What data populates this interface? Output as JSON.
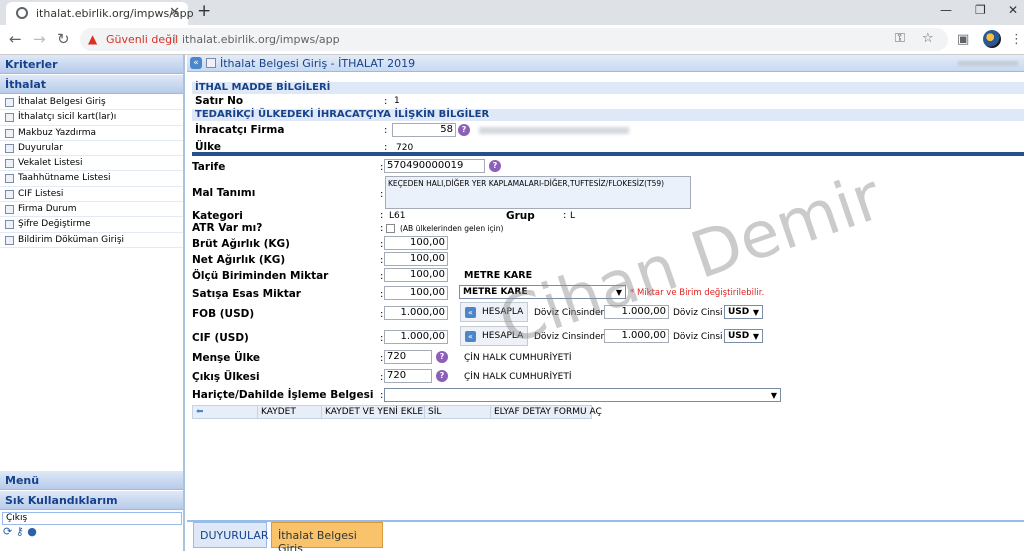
{
  "browser": {
    "tab_title": "ithalat.ebirlik.org/impws/app",
    "warning": "Güvenli değil",
    "url": "ithalat.ebirlik.org/impws/app"
  },
  "sidebar": {
    "kriterler": "Kriterler",
    "ithalat": "İthalat",
    "items": [
      "İthalat Belgesi Giriş",
      "İthalatçı sicil kart(lar)ı",
      "Makbuz Yazdırma",
      "Duyurular",
      "Vekalet Listesi",
      "Taahhütname Listesi",
      "CIF Listesi",
      "Firma Durum",
      "Şifre Değiştirme",
      "Bildirim Döküman Girişi"
    ],
    "menu": "Menü",
    "sik": "Sık Kullandıklarım",
    "cikis": "Çıkış"
  },
  "main": {
    "title": "İthalat Belgesi Giriş - İTHALAT 2019",
    "section1": "İTHAL MADDE BİLGİLERİ",
    "satir_no_label": "Satır No",
    "satir_no": "1",
    "section2": "TEDARİKÇİ ÜLKEDEKİ İHRACATÇIYA İLİŞKİN BİLGİLER",
    "ihracatci_label": "İhracatçı Firma",
    "ihracatci_value": "58",
    "ulke_label": "Ülke",
    "ulke_value": "720",
    "tarife_label": "Tarife",
    "tarife_value": "570490000019",
    "mal_label": "Mal Tanımı",
    "mal_value": "KEÇEDEN HALI,DİĞER YER KAPLAMALARI-DİĞER,TUFTESİZ/FLOKESİZ(T59)",
    "kategori_label": "Kategori",
    "kategori_value": "L61",
    "grup_label": "Grup",
    "grup_value": "L",
    "atr_label": "ATR Var mı?",
    "atr_note": "(AB ülkelerinden gelen için)",
    "brut_label": "Brüt Ağırlık (KG)",
    "brut_value": "100,00",
    "net_label": "Net Ağırlık (KG)",
    "net_value": "100,00",
    "olcu_label": "Ölçü Biriminden Miktar",
    "olcu_value": "100,00",
    "olcu_unit": "METRE KARE",
    "satis_label": "Satışa Esas Miktar",
    "satis_value": "100,00",
    "satis_unit": "METRE KARE",
    "satis_note": "* Miktar ve Birim değiştirilebilir.",
    "fob_label": "FOB (USD)",
    "fob_value": "1.000,00",
    "cif_label": "CIF (USD)",
    "cif_value": "1.000,00",
    "hesapla": "HESAPLA",
    "doviz_label": "Döviz Cinsinden :",
    "doviz_cins_label": "Döviz Cinsi :",
    "fob_doviz": "1.000,00",
    "cif_doviz": "1.000,00",
    "currency": "USD",
    "mense_label": "Menşe Ülke",
    "mense_value": "720",
    "mense_name": "ÇİN HALK CUMHURİYETİ",
    "cikis_label": "Çıkış Ülkesi",
    "cikis_value": "720",
    "cikis_name": "ÇİN HALK CUMHURİYETİ",
    "harice_label": "Hariçte/Dahilde İşleme Belgesi",
    "toolbar": [
      "KAYDET",
      "KAYDET VE YENİ EKLE",
      "SİL",
      "ELYAF DETAY FORMU AÇ"
    ]
  },
  "bottom_tabs": [
    "DUYURULAR",
    "İthalat Belgesi Giriş"
  ],
  "watermark": "Cihan Demir"
}
